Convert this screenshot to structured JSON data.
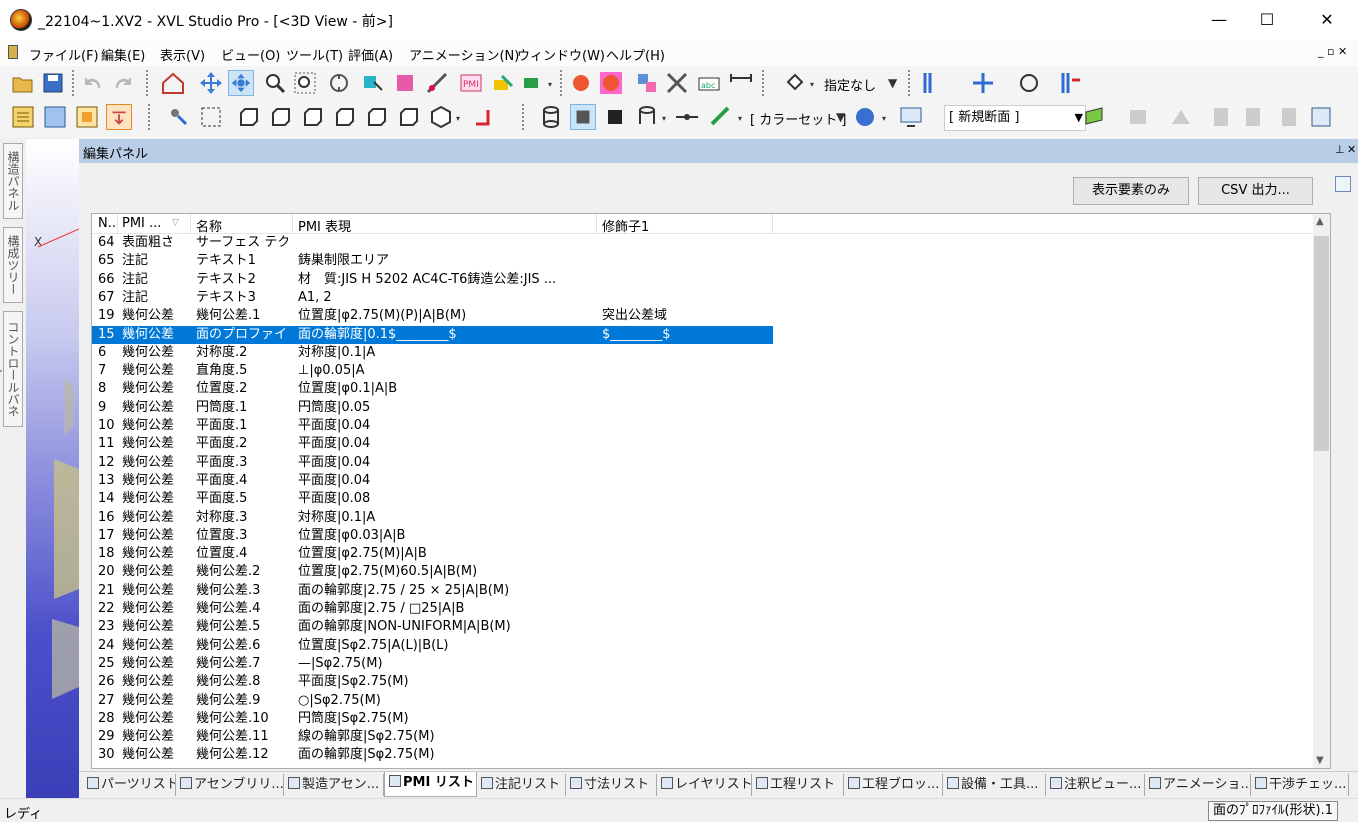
{
  "window": {
    "title": "_22104~1.XV2 - XVL Studio Pro - [<3D View - 前>]",
    "min": "—",
    "max": "☐",
    "close": "✕"
  },
  "menu": {
    "items": [
      "ファイル(F)",
      "編集(E)",
      "表示(V)",
      "ビュー(O)",
      "ツール(T)",
      "評価(A)",
      "アニメーション(N)",
      "ウィンドウ(W)",
      "ヘルプ(H)"
    ],
    "mdi": "_ ▫ ✕"
  },
  "toolbar1": {
    "display_combo": "指定なし"
  },
  "toolbar2": {
    "color_set": "[ カラーセット ]",
    "section_combo": "[ 新規断面 ]"
  },
  "side_tabs": [
    "構造パネル",
    "構成ツリー",
    "コントロールパネル"
  ],
  "viewport": {
    "axis_label": "X"
  },
  "panel": {
    "title": "編集パネル",
    "pin": "⊥",
    "close": "✕",
    "btn_visible_only": "表示要素のみ",
    "btn_csv": "CSV 出力..."
  },
  "table": {
    "columns": [
      "N..",
      "PMI ...",
      "名称",
      "PMI 表現",
      "修飾子1"
    ],
    "rows": [
      [
        "64",
        "表面粗さ",
        "サーフェス テクス...",
        "",
        ""
      ],
      [
        "65",
        "注記",
        "テキスト1",
        "鋳巣制限エリア",
        ""
      ],
      [
        "66",
        "注記",
        "テキスト2",
        "材　質:JIS H 5202 AC4C-T6鋳造公差:JIS ...",
        ""
      ],
      [
        "67",
        "注記",
        "テキスト3",
        " A1, 2",
        ""
      ],
      [
        "19",
        "幾何公差",
        "幾何公差.1",
        "位置度|φ2.75(M)(P)|A|B(M)",
        "突出公差域"
      ],
      [
        "15",
        "幾何公差",
        "面のプロファイ...",
        "面の輪郭度|0.1$________$",
        "$________$"
      ],
      [
        "6",
        "幾何公差",
        "対称度.2",
        "対称度|0.1|A",
        ""
      ],
      [
        "7",
        "幾何公差",
        "直角度.5",
        "⊥|φ0.05|A",
        ""
      ],
      [
        "8",
        "幾何公差",
        "位置度.2",
        "位置度|φ0.1|A|B",
        ""
      ],
      [
        "9",
        "幾何公差",
        "円筒度.1",
        "円筒度|0.05",
        ""
      ],
      [
        "10",
        "幾何公差",
        "平面度.1",
        "平面度|0.04",
        ""
      ],
      [
        "11",
        "幾何公差",
        "平面度.2",
        "平面度|0.04",
        ""
      ],
      [
        "12",
        "幾何公差",
        "平面度.3",
        "平面度|0.04",
        ""
      ],
      [
        "13",
        "幾何公差",
        "平面度.4",
        "平面度|0.04",
        ""
      ],
      [
        "14",
        "幾何公差",
        "平面度.5",
        "平面度|0.08",
        ""
      ],
      [
        "16",
        "幾何公差",
        "対称度.3",
        "対称度|0.1|A",
        ""
      ],
      [
        "17",
        "幾何公差",
        "位置度.3",
        "位置度|φ0.03|A|B",
        ""
      ],
      [
        "18",
        "幾何公差",
        "位置度.4",
        "位置度|φ2.75(M)|A|B",
        ""
      ],
      [
        "20",
        "幾何公差",
        "幾何公差.2",
        "位置度|φ2.75(M)60.5|A|B(M)",
        ""
      ],
      [
        "21",
        "幾何公差",
        "幾何公差.3",
        "面の輪郭度|2.75 / 25 × 25|A|B(M)",
        ""
      ],
      [
        "22",
        "幾何公差",
        "幾何公差.4",
        "面の輪郭度|2.75 / □25|A|B",
        ""
      ],
      [
        "23",
        "幾何公差",
        "幾何公差.5",
        "面の輪郭度|NON-UNIFORM|A|B(M)",
        ""
      ],
      [
        "24",
        "幾何公差",
        "幾何公差.6",
        "位置度|Sφ2.75|A(L)|B(L)",
        ""
      ],
      [
        "25",
        "幾何公差",
        "幾何公差.7",
        "—|Sφ2.75(M)",
        ""
      ],
      [
        "26",
        "幾何公差",
        "幾何公差.8",
        "平面度|Sφ2.75(M)",
        ""
      ],
      [
        "27",
        "幾何公差",
        "幾何公差.9",
        "○|Sφ2.75(M)",
        ""
      ],
      [
        "28",
        "幾何公差",
        "幾何公差.10",
        "円筒度|Sφ2.75(M)",
        ""
      ],
      [
        "29",
        "幾何公差",
        "幾何公差.11",
        "線の輪郭度|Sφ2.75(M)",
        ""
      ],
      [
        "30",
        "幾何公差",
        "幾何公差.12",
        "面の輪郭度|Sφ2.75(M)",
        ""
      ]
    ],
    "selected_row_index": 5
  },
  "bottom_tabs": [
    "パーツリスト",
    "アセンブリリ...",
    "製造アセン...",
    "PMI リスト",
    "注記リスト",
    "寸法リスト",
    "レイヤリスト",
    "工程リスト",
    "工程ブロッ...",
    "設備・工具...",
    "注釈ビュー...",
    "アニメーショ...",
    "干渉チェッ..."
  ],
  "active_tab_index": 3,
  "status": {
    "left": "レディ",
    "right": "面のﾌﾟﾛﾌｧｲﾙ(形状).1"
  }
}
